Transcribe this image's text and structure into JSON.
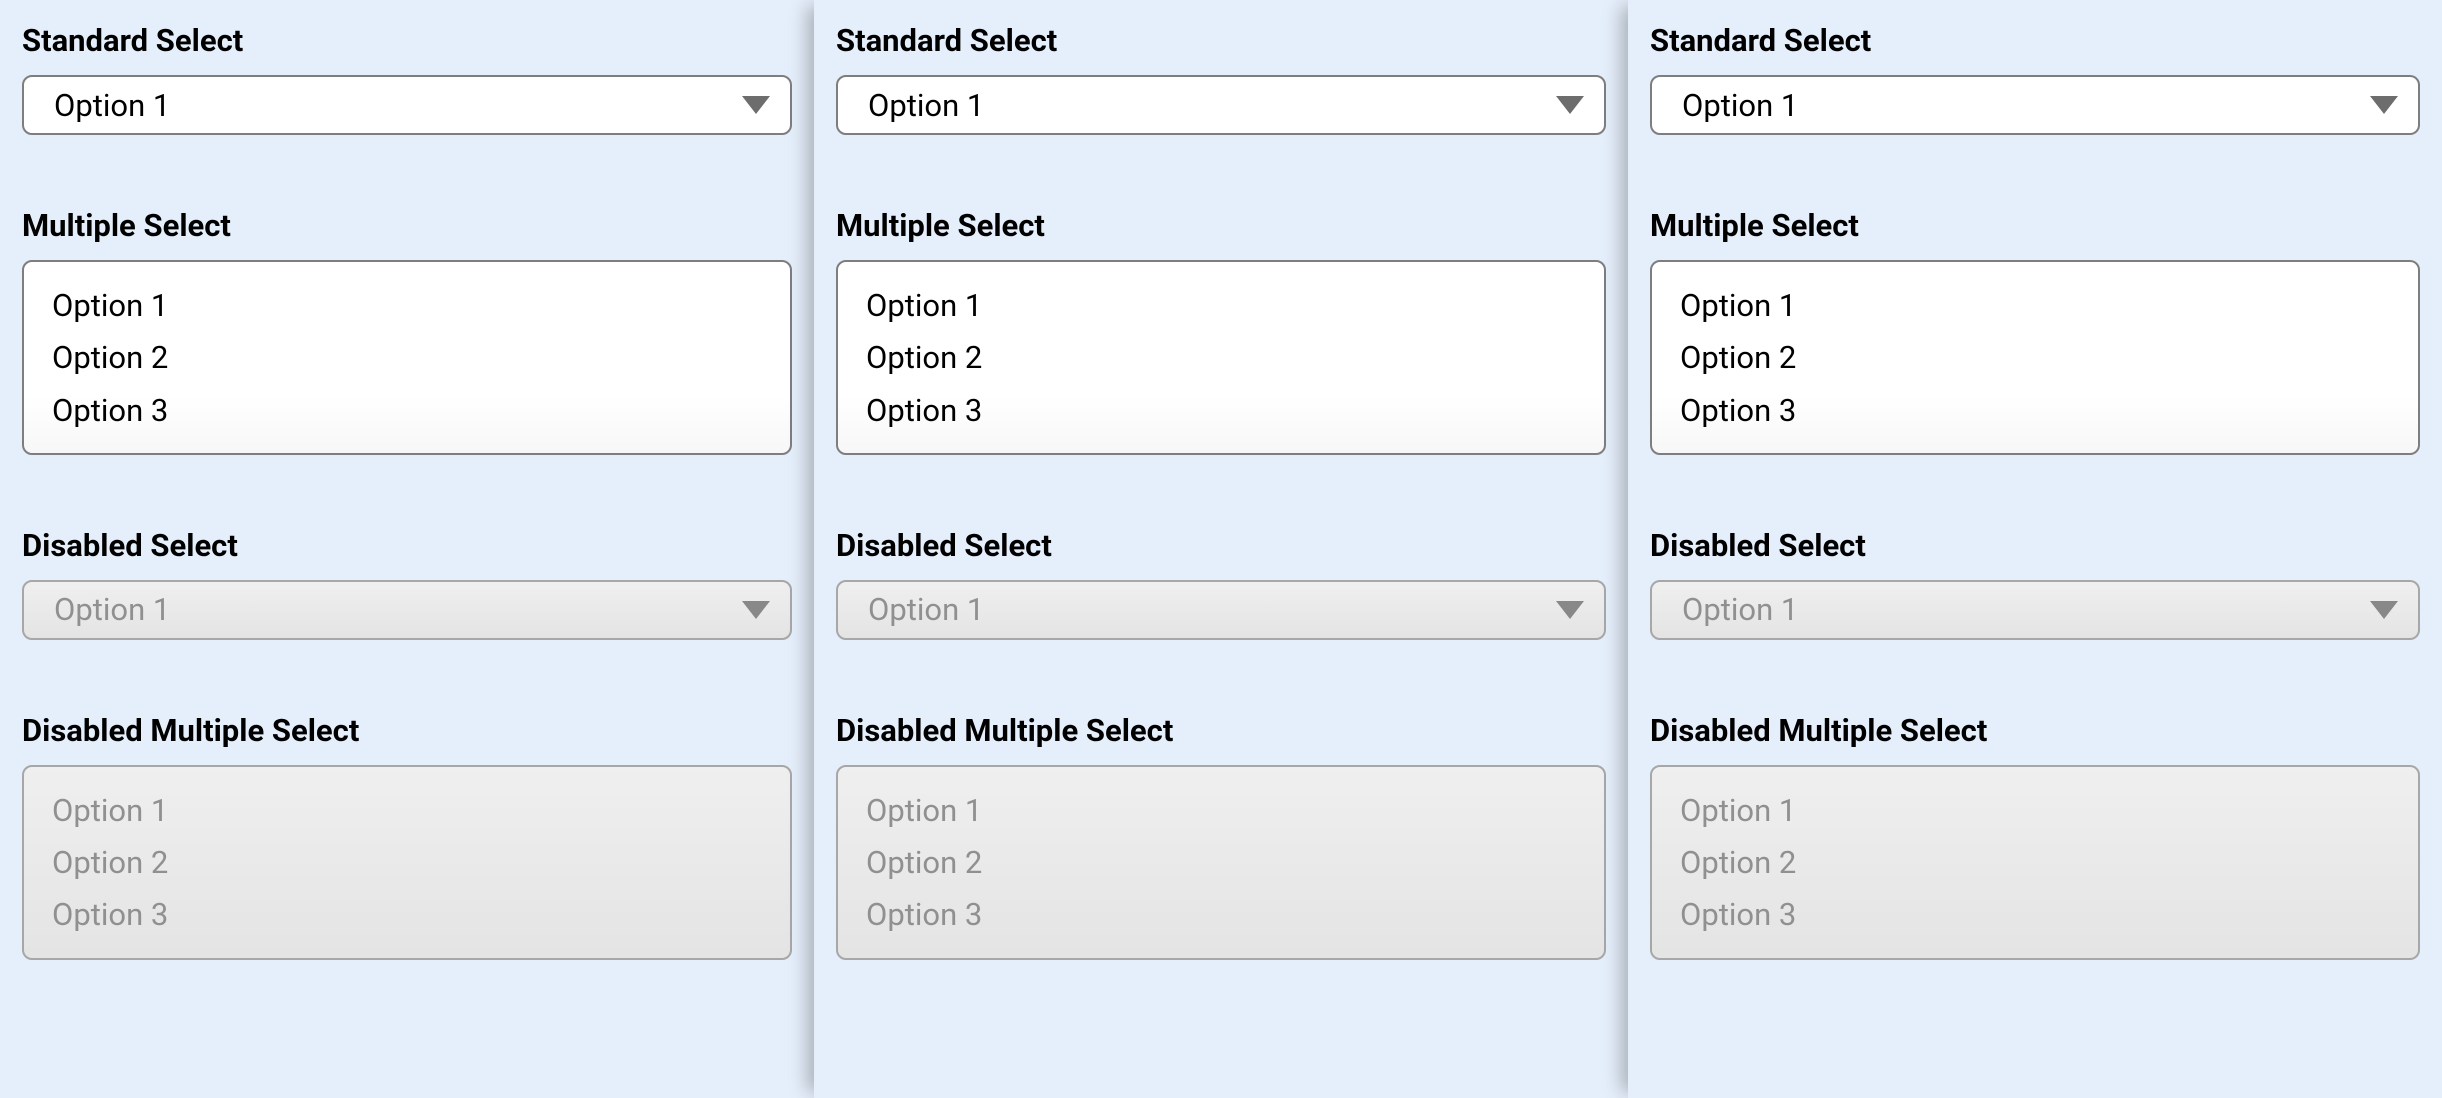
{
  "columns": [
    {
      "standard": {
        "label": "Standard Select",
        "value": "Option 1"
      },
      "multiple": {
        "label": "Multiple Select",
        "options": [
          "Option 1",
          "Option 2",
          "Option 3"
        ]
      },
      "disabled_single": {
        "label": "Disabled Select",
        "value": "Option 1"
      },
      "disabled_multiple": {
        "label": "Disabled Multiple Select",
        "options": [
          "Option 1",
          "Option 2",
          "Option 3"
        ]
      }
    },
    {
      "standard": {
        "label": "Standard Select",
        "value": "Option 1"
      },
      "multiple": {
        "label": "Multiple Select",
        "options": [
          "Option 1",
          "Option 2",
          "Option 3"
        ]
      },
      "disabled_single": {
        "label": "Disabled Select",
        "value": "Option 1"
      },
      "disabled_multiple": {
        "label": "Disabled Multiple Select",
        "options": [
          "Option 1",
          "Option 2",
          "Option 3"
        ]
      }
    },
    {
      "standard": {
        "label": "Standard Select",
        "value": "Option 1"
      },
      "multiple": {
        "label": "Multiple Select",
        "options": [
          "Option 1",
          "Option 2",
          "Option 3"
        ]
      },
      "disabled_single": {
        "label": "Disabled Select",
        "value": "Option 1"
      },
      "disabled_multiple": {
        "label": "Disabled Multiple Select",
        "options": [
          "Option 1",
          "Option 2",
          "Option 3"
        ]
      }
    }
  ]
}
